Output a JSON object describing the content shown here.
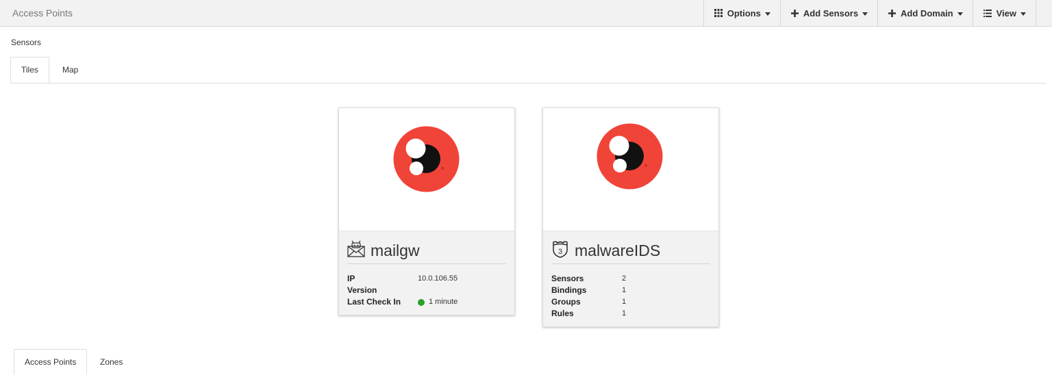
{
  "header": {
    "title": "Access Points",
    "menu": [
      {
        "label": "Options",
        "icon": "grid-icon"
      },
      {
        "label": "Add Sensors",
        "icon": "plus-icon"
      },
      {
        "label": "Add Domain",
        "icon": "plus-icon"
      },
      {
        "label": "View",
        "icon": "list-icon"
      }
    ]
  },
  "section": {
    "label": "Sensors",
    "tabs": [
      "Tiles",
      "Map"
    ],
    "active_tab": "Tiles"
  },
  "cards": [
    {
      "icon": "mail-robot-icon",
      "title": "mailgw",
      "fields": [
        {
          "key": "IP",
          "value": "10.0.106.55"
        },
        {
          "key": "Version",
          "value": ""
        },
        {
          "key": "Last Check In",
          "value": "1 minute",
          "status_color": "#2aa02a"
        }
      ]
    },
    {
      "icon": "shield-3-icon",
      "title": "malwareIDS",
      "fields": [
        {
          "key": "Sensors",
          "value": "2"
        },
        {
          "key": "Bindings",
          "value": "1"
        },
        {
          "key": "Groups",
          "value": "1"
        },
        {
          "key": "Rules",
          "value": "1"
        }
      ]
    }
  ],
  "bottom_tabs": [
    "Access Points",
    "Zones"
  ],
  "bottom_active_tab": "Access Points",
  "colors": {
    "logo_red": "#f04438",
    "logo_dark": "#111111",
    "status_green": "#2aa02a"
  }
}
